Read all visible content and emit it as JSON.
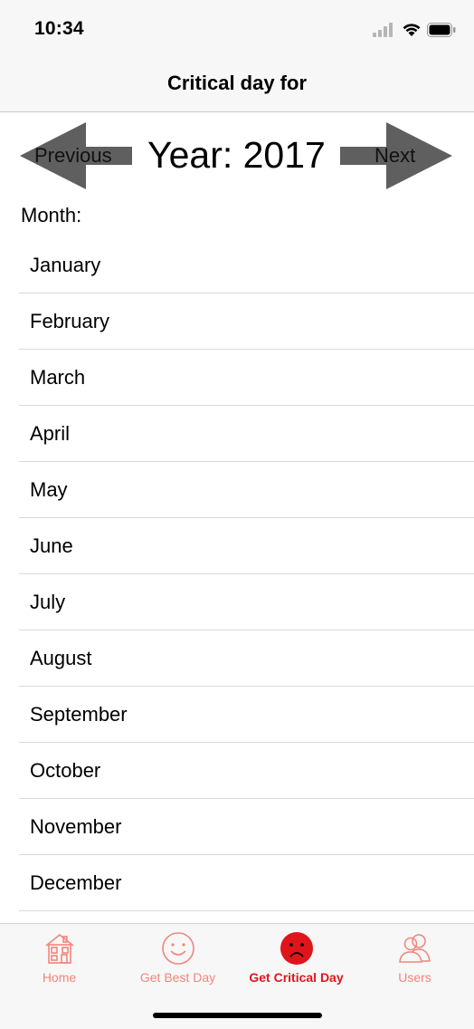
{
  "status_bar": {
    "time": "10:34",
    "icons": [
      "cellular-signal-icon",
      "wifi-icon",
      "battery-icon"
    ]
  },
  "nav": {
    "title": "Critical day for"
  },
  "year_selector": {
    "previous_label": "Previous",
    "next_label": "Next",
    "year_text": "Year: 2017"
  },
  "month_label": "Month:",
  "months": [
    {
      "label": "January"
    },
    {
      "label": "February"
    },
    {
      "label": "March"
    },
    {
      "label": "April"
    },
    {
      "label": "May"
    },
    {
      "label": "June"
    },
    {
      "label": "July"
    },
    {
      "label": "August"
    },
    {
      "label": "September"
    },
    {
      "label": "October"
    },
    {
      "label": "November"
    },
    {
      "label": "December"
    }
  ],
  "tab_bar": {
    "tabs": [
      {
        "label": "Home",
        "icon": "house-icon",
        "active": false
      },
      {
        "label": "Get Best Day",
        "icon": "smiley-face-icon",
        "active": false
      },
      {
        "label": "Get Critical Day",
        "icon": "sad-face-icon",
        "active": true
      },
      {
        "label": "Users",
        "icon": "users-icon",
        "active": false
      }
    ]
  },
  "colors": {
    "accent_active": "#e0151b",
    "accent_inactive": "#f0867c",
    "arrow_fill": "#5f5f5f",
    "bar_background": "#f7f7f7"
  }
}
